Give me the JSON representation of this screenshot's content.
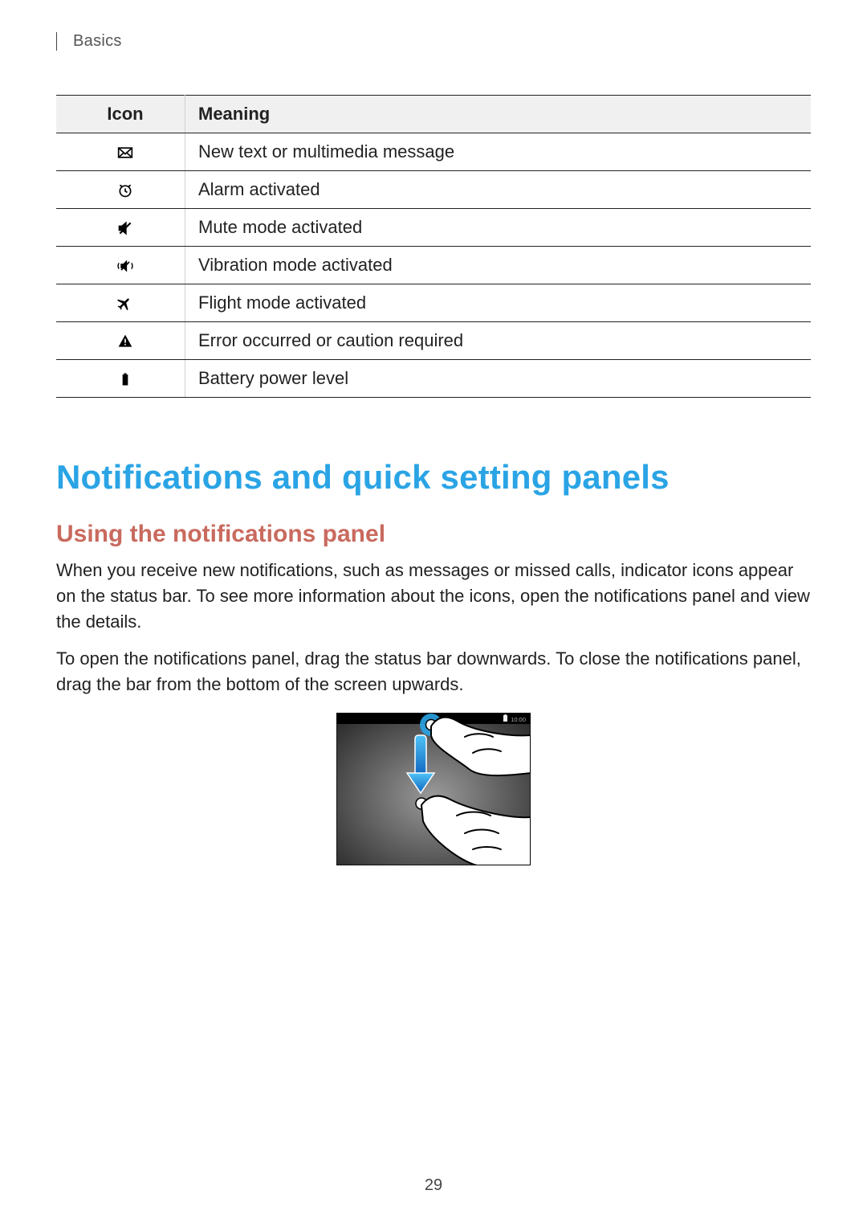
{
  "header": {
    "section": "Basics"
  },
  "table": {
    "columns": {
      "icon": "Icon",
      "meaning": "Meaning"
    },
    "rows": [
      {
        "icon_name": "message-icon",
        "meaning": "New text or multimedia message"
      },
      {
        "icon_name": "alarm-icon",
        "meaning": "Alarm activated"
      },
      {
        "icon_name": "mute-icon",
        "meaning": "Mute mode activated"
      },
      {
        "icon_name": "vibration-icon",
        "meaning": "Vibration mode activated"
      },
      {
        "icon_name": "flight-icon",
        "meaning": "Flight mode activated"
      },
      {
        "icon_name": "error-icon",
        "meaning": "Error occurred or caution required"
      },
      {
        "icon_name": "battery-icon",
        "meaning": "Battery power level"
      }
    ]
  },
  "content": {
    "h1": "Notifications and quick setting panels",
    "h2": "Using the notifications panel",
    "p1": "When you receive new notifications, such as messages or missed calls, indicator icons appear on the status bar. To see more information about the icons, open the notifications panel and view the details.",
    "p2": "To open the notifications panel, drag the status bar downwards. To close the notifications panel, drag the bar from the bottom of the screen upwards."
  },
  "illustration": {
    "status_time": "10:00"
  },
  "page_number": "29"
}
